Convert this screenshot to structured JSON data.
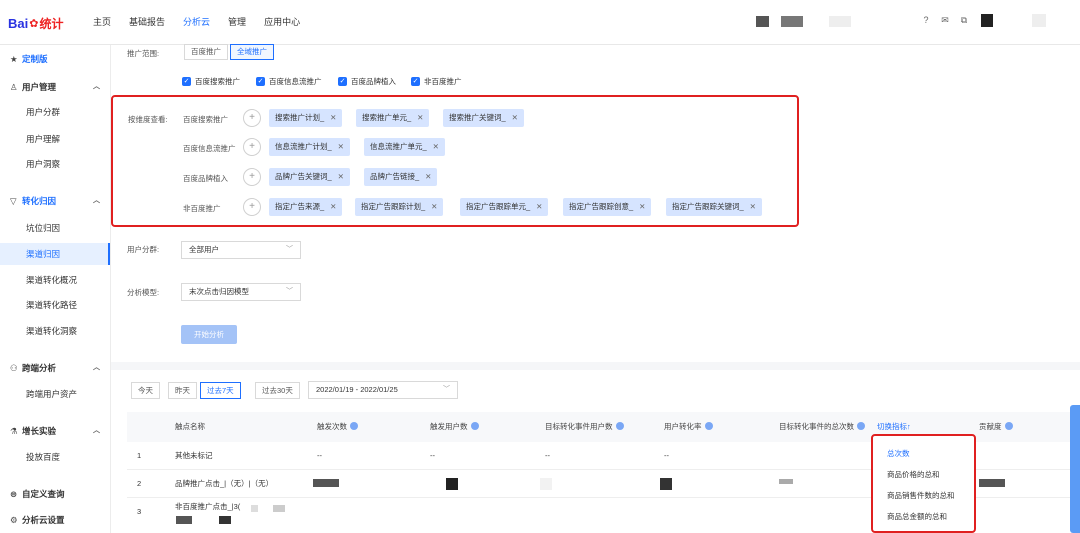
{
  "header": {
    "logo": {
      "part1": "Bai",
      "part2": "统计"
    },
    "nav": [
      "主页",
      "基础报告",
      "分析云",
      "管理",
      "应用中心"
    ],
    "active_nav": "分析云",
    "icons": [
      "help-icon",
      "mail-icon",
      "copy-icon"
    ]
  },
  "sidebar": {
    "custom": "定制版",
    "groups": [
      {
        "label": "用户管理",
        "icon": "user-icon",
        "items": [
          "用户分群",
          "用户理解",
          "用户洞察"
        ]
      },
      {
        "label": "转化归因",
        "icon": "funnel-icon",
        "items": [
          "坑位归因",
          "渠道归因",
          "渠道转化概况",
          "渠道转化路径",
          "渠道转化洞察"
        ]
      },
      {
        "label": "跨端分析",
        "icon": "cross-device-icon",
        "items": [
          "跨端用户资产"
        ]
      },
      {
        "label": "增长实验",
        "icon": "experiment-icon",
        "items": [
          "投放百度"
        ]
      }
    ],
    "bottom": [
      {
        "label": "自定义查询",
        "icon": "query-icon"
      },
      {
        "label": "分析云设置",
        "icon": "settings-icon"
      }
    ],
    "selected": "渠道归因"
  },
  "filters": {
    "scope_label": "推广范围:",
    "scope_options": [
      "百度推广",
      "全域推广"
    ],
    "scope_active": "全域推广",
    "checkboxes": [
      "百度搜索推广",
      "百度信息流推广",
      "百度品牌植入",
      "非百度推广"
    ],
    "dim_label": "按维度查看:",
    "dim_rows": [
      {
        "label": "百度搜索推广",
        "tags": [
          "搜索推广计划_",
          "搜索推广单元_",
          "搜索推广关键词_"
        ]
      },
      {
        "label": "百度信息流推广",
        "tags": [
          "信息流推广计划_",
          "信息流推广单元_"
        ]
      },
      {
        "label": "百度品牌植入",
        "tags": [
          "品牌广告关键词_",
          "品牌广告链接_"
        ]
      },
      {
        "label": "非百度推广",
        "tags": [
          "指定广告来源_",
          "指定广告跟踪计划_",
          "指定广告跟踪单元_",
          "指定广告跟踪创意_",
          "指定广告跟踪关键词_"
        ]
      }
    ],
    "segment_label": "用户分群:",
    "segment_value": "全部用户",
    "model_label": "分析模型:",
    "model_value": "末次点击归因模型",
    "start_btn": "开始分析"
  },
  "date": {
    "tabs": [
      "今天",
      "昨天",
      "过去7天",
      "过去30天"
    ],
    "active": "过去7天",
    "range": "2022/01/19 - 2022/01/25"
  },
  "table": {
    "headers": [
      "触点名称",
      "触发次数",
      "触发用户数",
      "目标转化事件用户数",
      "用户转化率",
      "目标转化事件的总次数",
      "切换指标",
      "贡献度"
    ],
    "rows": [
      {
        "no": "1",
        "name": "其他未标记",
        "c1": "--",
        "c2": "--",
        "c3": "--",
        "c4": "--"
      },
      {
        "no": "2",
        "name": "品牌推广点击_|（无）|（无）"
      },
      {
        "no": "3",
        "name": "非百度推广点击_|3("
      }
    ]
  },
  "metric_popup": {
    "items": [
      "总次数",
      "商品价格的总和",
      "商品销售件数的总和",
      "商品总金额的总和"
    ],
    "active": "总次数"
  }
}
